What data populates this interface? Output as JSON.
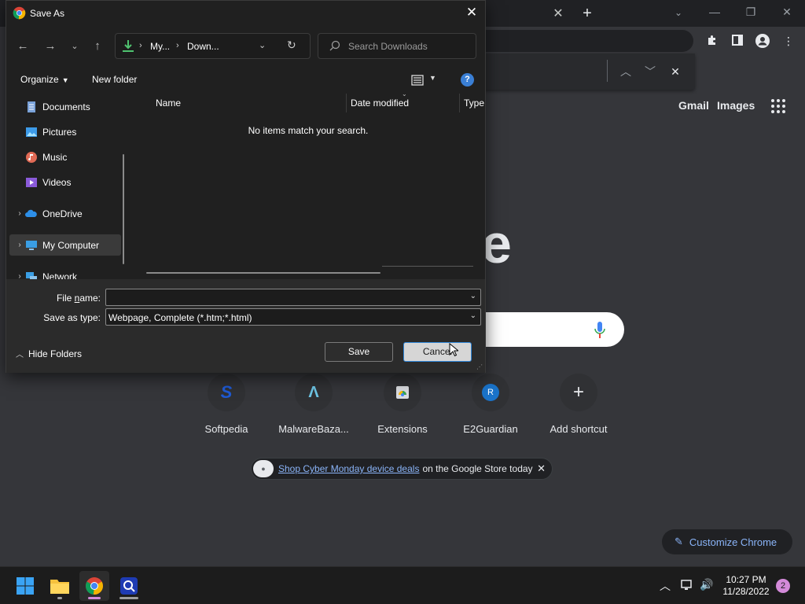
{
  "colors": {
    "chrome_bg": "#35363a",
    "dialog_bg": "#202020",
    "accent": "#8ab4f8",
    "taskbar": "#1c1c1c"
  },
  "chrome": {
    "ntp_links": {
      "gmail": "Gmail",
      "images": "Images"
    },
    "logo_fragment": "e",
    "shortcuts": [
      {
        "label": "Softpedia",
        "icon": "softpedia-icon"
      },
      {
        "label": "MalwareBaza...",
        "icon": "malwarebazaar-icon"
      },
      {
        "label": "Extensions",
        "icon": "extensions-icon"
      },
      {
        "label": "E2Guardian",
        "icon": "e2guardian-icon",
        "letter": "R"
      },
      {
        "label": "Add shortcut",
        "icon": "plus-icon",
        "glyph": "+"
      }
    ],
    "promo": {
      "link": "Shop Cyber Monday device deals",
      "rest": "on the Google Store today",
      "close": "✕"
    },
    "customize": "Customize Chrome"
  },
  "dialog": {
    "title": "Save As",
    "address": {
      "crumb1": "My...",
      "crumb2": "Down..."
    },
    "search_placeholder": "Search Downloads",
    "toolbar": {
      "organize": "Organize",
      "new_folder": "New folder"
    },
    "nav_items": [
      {
        "label": "Documents",
        "icon": "documents-icon",
        "pinned": true
      },
      {
        "label": "Pictures",
        "icon": "pictures-icon",
        "pinned": true
      },
      {
        "label": "Music",
        "icon": "music-icon",
        "pinned": false
      },
      {
        "label": "Videos",
        "icon": "videos-icon",
        "pinned": false
      },
      {
        "label": "OneDrive",
        "icon": "onedrive-icon",
        "expandable": true
      },
      {
        "label": "My Computer",
        "icon": "computer-icon",
        "expandable": true,
        "selected": true
      },
      {
        "label": "Network",
        "icon": "network-icon",
        "expandable": true
      }
    ],
    "columns": {
      "name": "Name",
      "date_modified": "Date modified",
      "type": "Type"
    },
    "empty_message": "No items match your search.",
    "file_name_label_pre": "File ",
    "file_name_label_u": "n",
    "file_name_label_post": "ame:",
    "file_name_value": "",
    "save_type_label": "Save as type:",
    "save_type_value": "Webpage, Complete (*.htm;*.html)",
    "hide_folders": "Hide Folders",
    "save_label": "Save",
    "cancel_label": "Cancel"
  },
  "taskbar": {
    "time": "10:27 PM",
    "date": "11/28/2022",
    "notifications": "2"
  }
}
